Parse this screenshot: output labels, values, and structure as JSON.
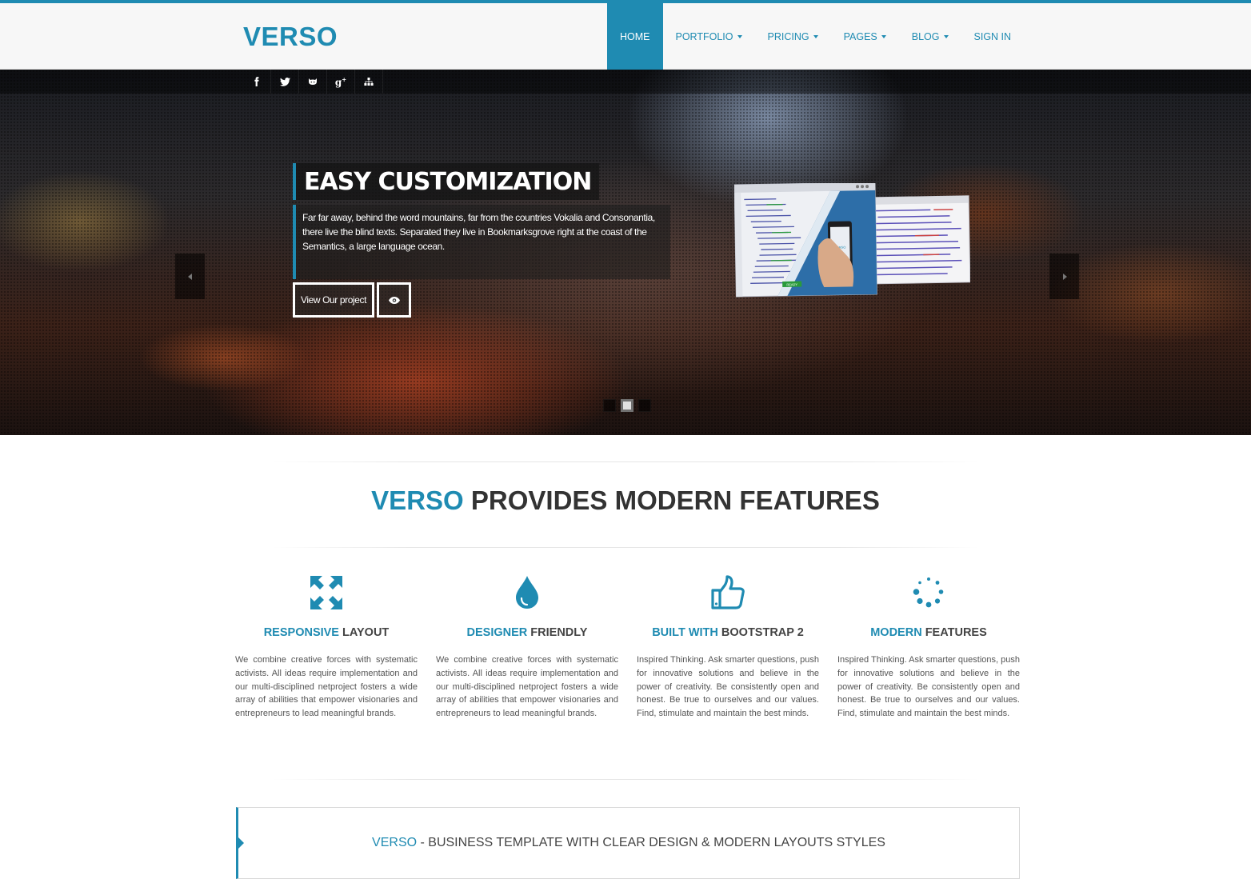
{
  "header": {
    "logo": "VERSO",
    "nav": [
      {
        "label": "HOME",
        "active": true,
        "dropdown": false
      },
      {
        "label": "PORTFOLIO",
        "active": false,
        "dropdown": true
      },
      {
        "label": "PRICING",
        "active": false,
        "dropdown": true
      },
      {
        "label": "PAGES",
        "active": false,
        "dropdown": true
      },
      {
        "label": "BLOG",
        "active": false,
        "dropdown": true
      },
      {
        "label": "SIGN IN",
        "active": false,
        "dropdown": false
      }
    ]
  },
  "social": [
    "facebook-icon",
    "twitter-icon",
    "github-icon",
    "google-plus-icon",
    "sitemap-icon"
  ],
  "hero": {
    "title": "EASY CUSTOMIZATION",
    "text": "Far far away, behind the word mountains, far from the countries Vokalia and Consonantia, there live the blind texts. Separated they live in Bookmarksgrove right at the coast of the Semantics, a large language ocean.",
    "button_label": "View Our project",
    "slides": 3,
    "active_slide": 2
  },
  "features_section": {
    "title_accent": "VERSO",
    "title_rest": " PROVIDES MODERN FEATURES",
    "items": [
      {
        "icon": "resize-arrows-icon",
        "head_accent": "RESPONSIVE",
        "head_rest": " LAYOUT",
        "text": "We combine creative forces with systematic activists. All ideas require implementation and our multi-disciplined netproject fosters a wide array of abilities that empower visionaries and entrepreneurs to lead meaningful brands."
      },
      {
        "icon": "droplet-icon",
        "head_accent": "DESIGNER",
        "head_rest": " FRIENDLY",
        "text": "We combine creative forces with systematic activists. All ideas require implementation and our multi-disciplined netproject fosters a wide array of abilities that empower visionaries and entrepreneurs to lead meaningful brands."
      },
      {
        "icon": "thumbs-up-icon",
        "head_accent": "BUILT WITH",
        "head_rest": " BOOTSTRAP 2",
        "text": "Inspired Thinking. Ask smarter questions, push for innovative solutions and believe in the power of creativity. Be consistently open and honest. Be true to ourselves and our values. Find, stimulate and maintain the best minds."
      },
      {
        "icon": "spinner-icon",
        "head_accent": "MODERN",
        "head_rest": " FEATURES",
        "text": "Inspired Thinking. Ask smarter questions, push for innovative solutions and believe in the power of creativity. Be consistently open and honest. Be true to ourselves and our values. Find, stimulate and maintain the best minds."
      }
    ]
  },
  "banner": {
    "accent": "VERSO",
    "rest": " - BUSINESS TEMPLATE WITH CLEAR DESIGN & MODERN LAYOUTS STYLES"
  },
  "colors": {
    "accent": "#1f8bb2",
    "text": "#444444"
  }
}
